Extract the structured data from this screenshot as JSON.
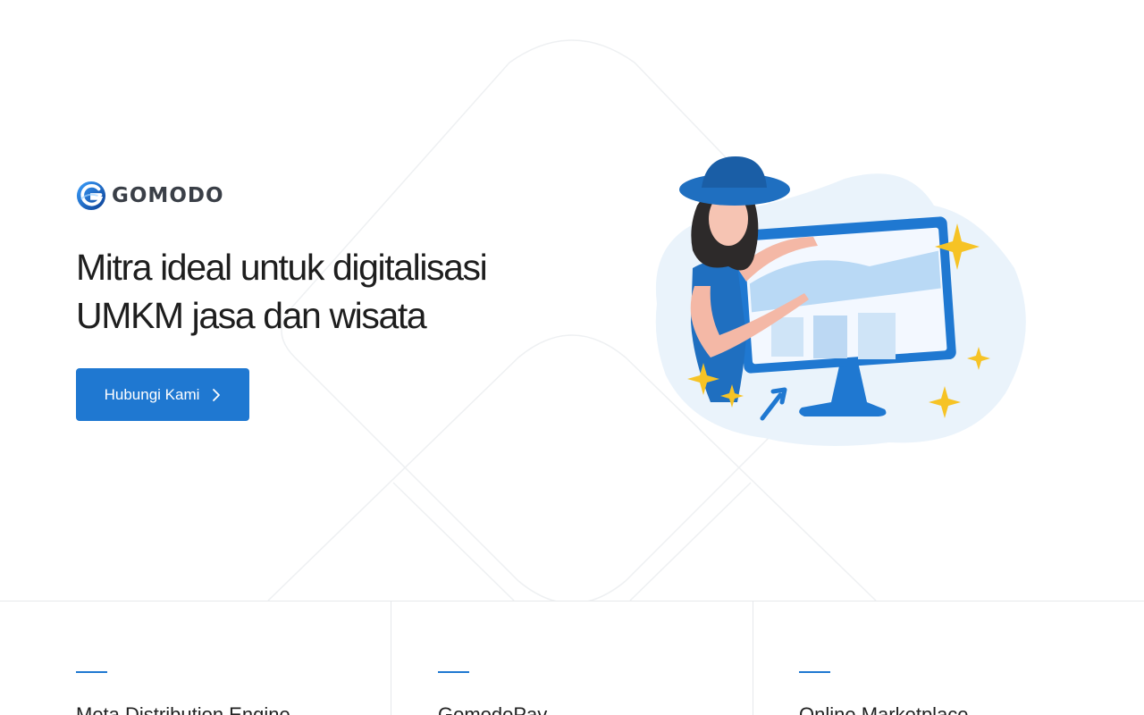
{
  "brand": {
    "name": "GOMODO",
    "logo_icon": "gomodo-g-logo-icon",
    "accent_color": "#1f78d1"
  },
  "hero": {
    "headline_line1": "Mitra ideal untuk digitalisasi",
    "headline_line2": "UMKM jasa dan wisata",
    "cta_label": "Hubungi Kami",
    "cta_icon": "chevron-right-icon",
    "illustration": "woman-presenting-monitor-illustration"
  },
  "features": [
    {
      "title": "Meta Distribution Engine"
    },
    {
      "title": "GomodoPay"
    },
    {
      "title": "Online Marketplace"
    }
  ]
}
